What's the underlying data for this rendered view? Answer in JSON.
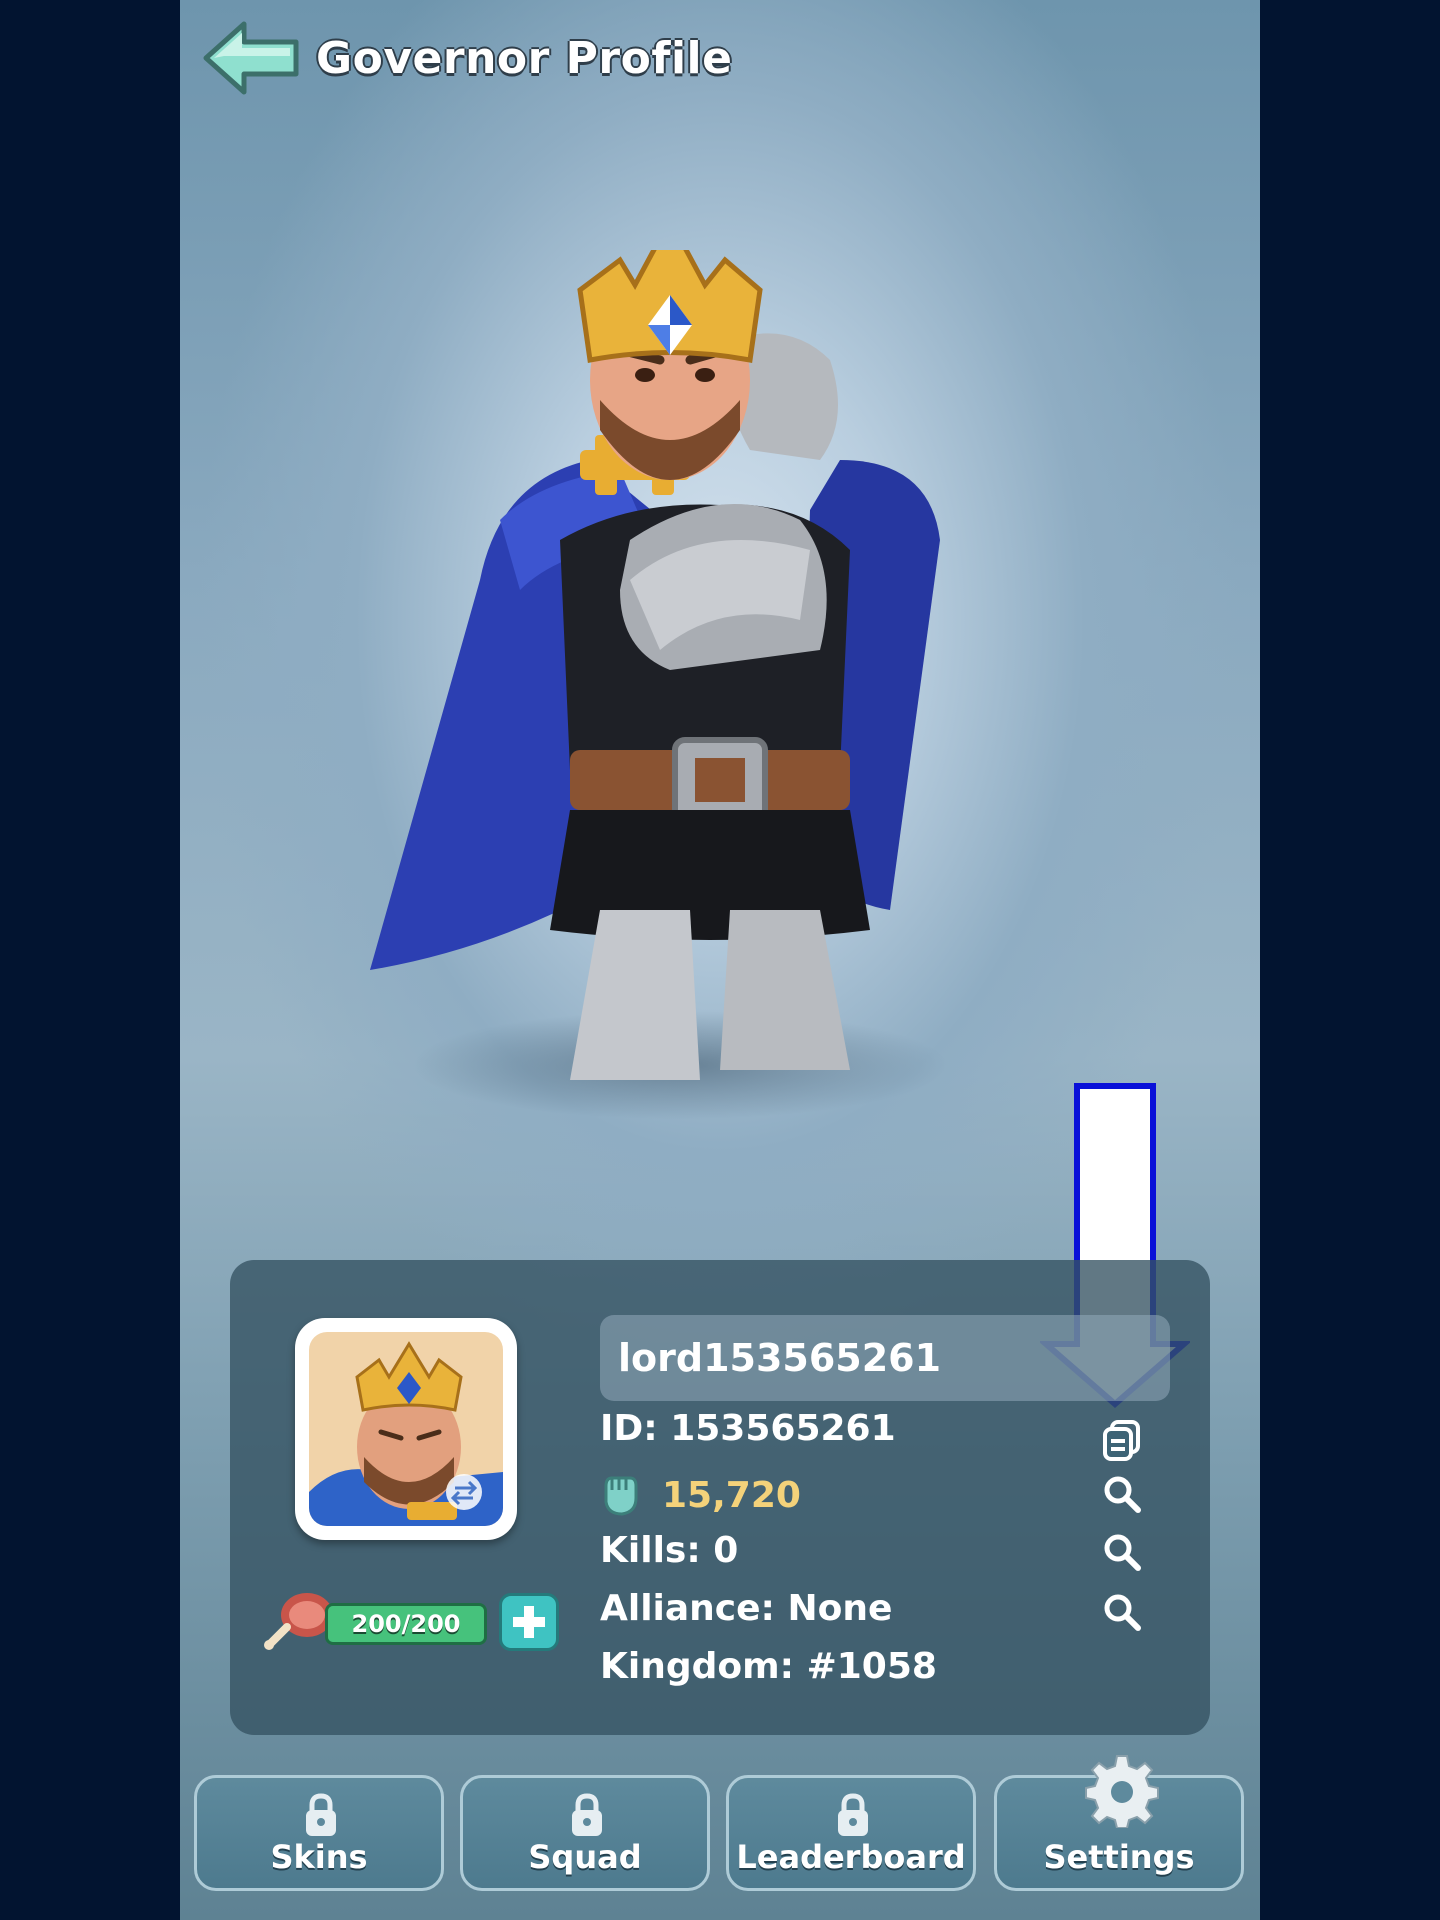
{
  "header": {
    "title": "Governor Profile",
    "back_icon": "back-arrow-icon"
  },
  "profile": {
    "name": "lord153565261",
    "id_text": "ID: 153565261",
    "power_value": "15,720",
    "kills_text": "Kills: 0",
    "alliance_text": "Alliance: None",
    "kingdom_text": "Kingdom: #1058",
    "stamina_text": "200/200",
    "stamina_fraction": 1.0
  },
  "tabs": [
    {
      "label": "Skins",
      "icon": "lock-icon"
    },
    {
      "label": "Squad",
      "icon": "lock-icon"
    },
    {
      "label": "Leaderboard",
      "icon": "lock-icon"
    },
    {
      "label": "Settings",
      "icon": "gear-icon"
    }
  ],
  "colors": {
    "background": "#021430",
    "power": "#f4d27a",
    "stamina": "#46c27c",
    "plus": "#3fc3c2",
    "arrow_outline": "#0a10d8"
  }
}
